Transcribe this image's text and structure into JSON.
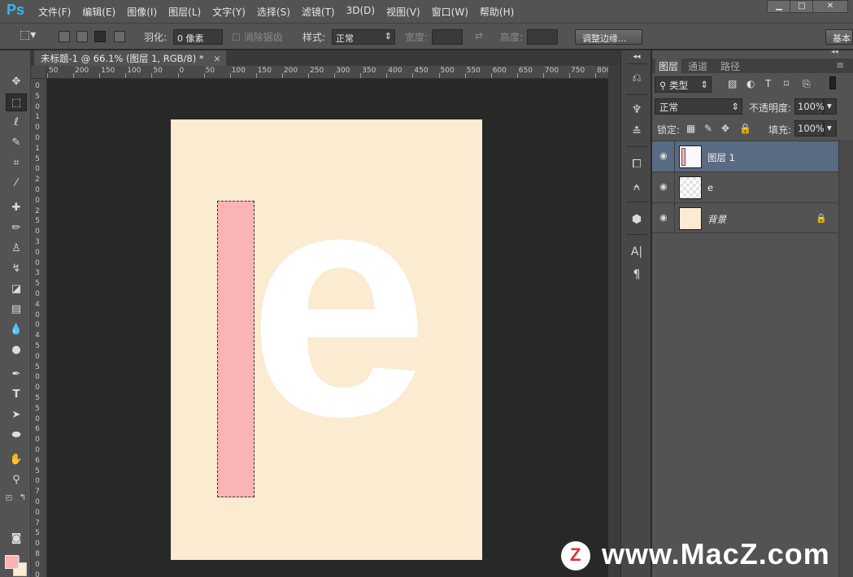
{
  "app": {
    "logo": "Ps"
  },
  "menu": [
    "文件(F)",
    "编辑(E)",
    "图像(I)",
    "图层(L)",
    "文字(Y)",
    "选择(S)",
    "滤镜(T)",
    "3D(D)",
    "视图(V)",
    "窗口(W)",
    "帮助(H)"
  ],
  "window_controls": {
    "minimize": "▁",
    "maximize": "□",
    "close": "✕"
  },
  "options": {
    "feather_label": "羽化:",
    "feather_value": "0 像素",
    "antialias_label": "消除锯齿",
    "style_label": "样式:",
    "style_value": "正常",
    "width_label": "宽度:",
    "height_label": "高度:",
    "refine_edge": "调整边缘...",
    "workspace": "基本"
  },
  "document": {
    "tab_title": "未标题-1 @ 66.1% (图层 1, RGB/8) *",
    "close": "×",
    "big_letter": "e"
  },
  "ruler_h": [
    "50",
    "200",
    "150",
    "100",
    "50",
    "0",
    "50",
    "100",
    "150",
    "200",
    "250",
    "300",
    "350",
    "400",
    "450",
    "500",
    "550",
    "600",
    "650",
    "700",
    "750",
    "800"
  ],
  "ruler_v": [
    "0",
    "5",
    "0",
    "1",
    "0",
    "0",
    "1",
    "5",
    "0",
    "2",
    "0",
    "0",
    "2",
    "5",
    "0",
    "3",
    "0",
    "0",
    "3",
    "5",
    "0",
    "4",
    "0",
    "0",
    "4",
    "5",
    "0",
    "5",
    "0",
    "0",
    "5",
    "5",
    "0",
    "6",
    "0",
    "0",
    "6",
    "5",
    "0",
    "7",
    "0",
    "0",
    "7",
    "5",
    "0",
    "8",
    "0",
    "0"
  ],
  "layers_panel": {
    "tabs": [
      "图层",
      "通道",
      "路径"
    ],
    "filter_kind": "类型",
    "blend_mode": "正常",
    "opacity_label": "不透明度:",
    "opacity_value": "100%",
    "lock_label": "锁定:",
    "fill_label": "填充:",
    "fill_value": "100%",
    "layers": [
      {
        "name": "图层 1",
        "selected": true
      },
      {
        "name": "e",
        "selected": false
      },
      {
        "name": "背景",
        "selected": false,
        "locked": true
      }
    ]
  },
  "colors": {
    "foreground": "#fbb3b4",
    "background": "#fcecd0",
    "canvas": "#faebd1",
    "selection": "#fbb4b5"
  },
  "watermark": {
    "logo_letter": "Z",
    "text": "www.MacZ.com"
  }
}
